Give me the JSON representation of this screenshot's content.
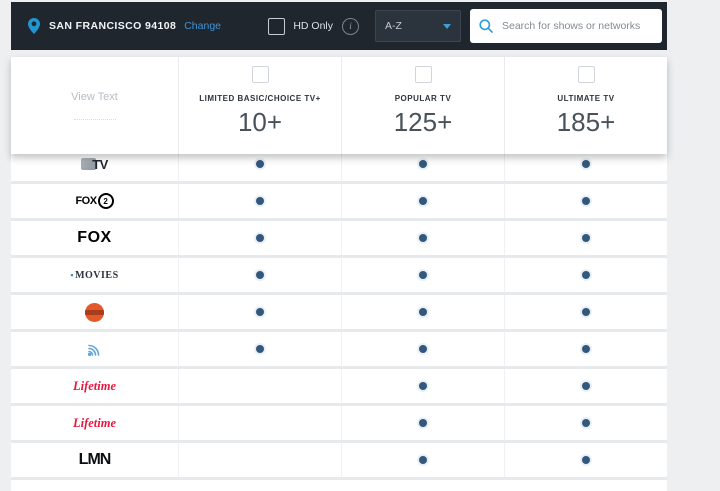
{
  "header": {
    "location": {
      "label": "SAN FRANCISCO 94108",
      "change_label": "Change"
    },
    "hd_only_label": "HD Only",
    "sort": {
      "value": "A-Z"
    },
    "search": {
      "placeholder": "Search for shows or networks"
    }
  },
  "plan_header": {
    "view_text_label": "View Text",
    "plans": [
      {
        "name": "LIMITED BASIC/CHOICE TV+",
        "count": "10+",
        "checked": false
      },
      {
        "name": "POPULAR TV",
        "count": "125+",
        "checked": false
      },
      {
        "name": "ULTIMATE TV",
        "count": "185+",
        "checked": false
      }
    ]
  },
  "table": {
    "rows": [
      {
        "logo": {
          "type": "tv-box",
          "name": "gray-tv-logo",
          "text": "TV"
        },
        "availability": [
          true,
          true,
          true
        ]
      },
      {
        "logo": {
          "type": "fox2",
          "name": "fox-2-logo",
          "text": "FOX",
          "badge": "2"
        },
        "availability": [
          true,
          true,
          true
        ]
      },
      {
        "logo": {
          "type": "fox",
          "name": "fox-logo",
          "text": "FOX"
        },
        "availability": [
          true,
          true,
          true
        ]
      },
      {
        "logo": {
          "type": "movies",
          "name": "movies-logo",
          "text": "MOVIES"
        },
        "availability": [
          true,
          true,
          true
        ]
      },
      {
        "logo": {
          "type": "orange-ball",
          "name": "orange-ball-logo"
        },
        "availability": [
          true,
          true,
          true
        ]
      },
      {
        "logo": {
          "type": "signal-arcs",
          "name": "signal-dish-logo"
        },
        "availability": [
          true,
          true,
          true
        ]
      },
      {
        "logo": {
          "type": "lifetime",
          "name": "lifetime-logo",
          "text": "Lifetime"
        },
        "availability": [
          false,
          true,
          true
        ]
      },
      {
        "logo": {
          "type": "lifetime",
          "name": "lifetime-logo",
          "text": "Lifetime"
        },
        "availability": [
          false,
          true,
          true
        ]
      },
      {
        "logo": {
          "type": "lmn",
          "name": "lmn-logo",
          "text": "LMN"
        },
        "availability": [
          false,
          true,
          true
        ]
      }
    ]
  },
  "colors": {
    "topbar_bg": "#20262e",
    "accent_blue": "#2f9bd6",
    "dot": "#33587c",
    "lifetime_red": "#e8173d",
    "page_bg": "#edeff1"
  }
}
